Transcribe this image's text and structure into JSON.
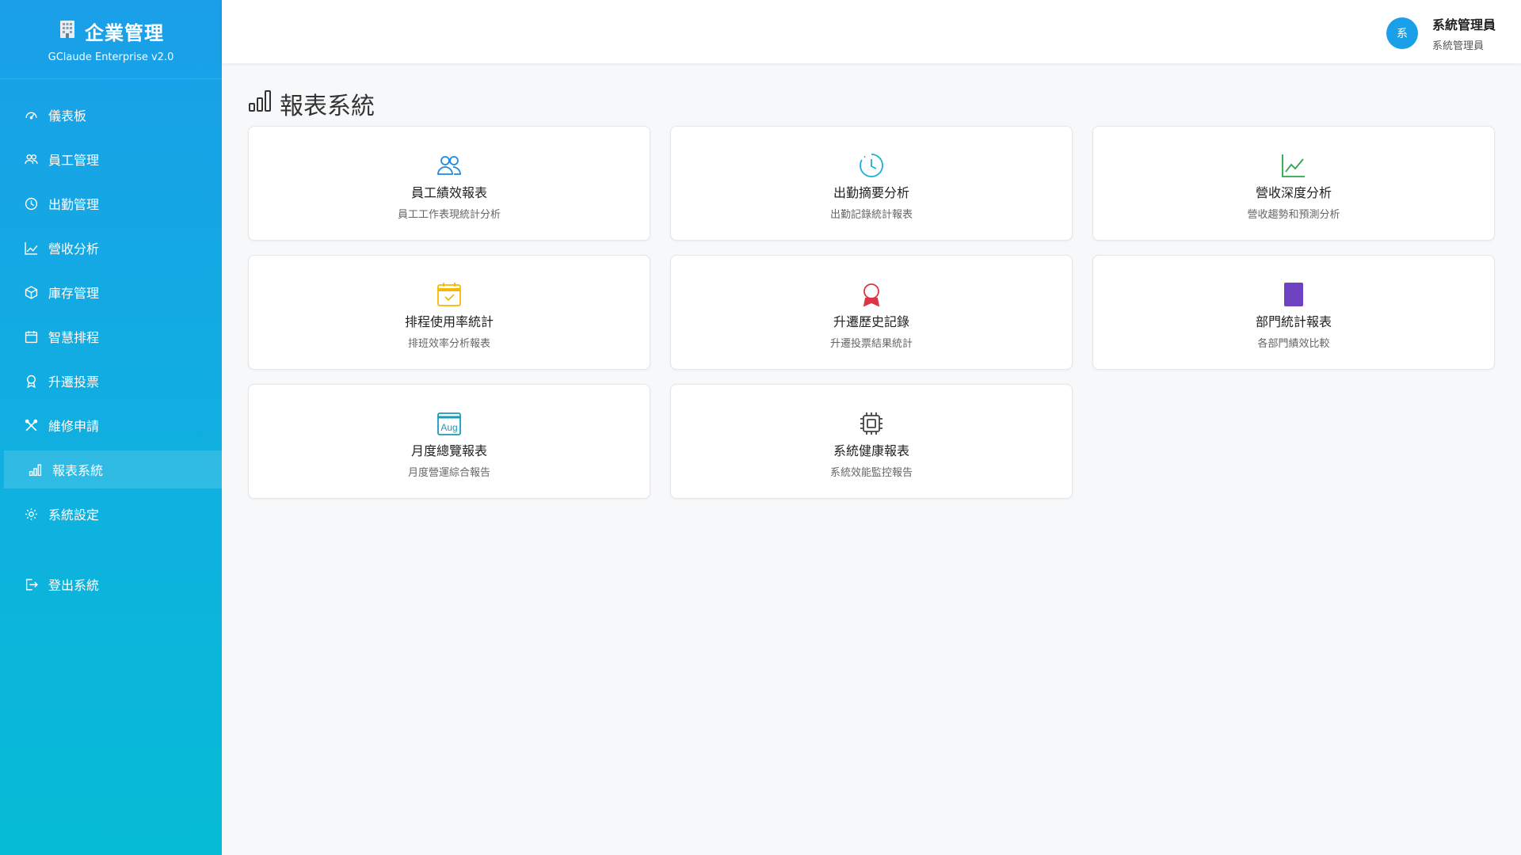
{
  "brand": {
    "title": "企業管理",
    "subtitle": "GClaude Enterprise v2.0"
  },
  "sidebar": {
    "items": [
      {
        "label": "儀表板",
        "icon": "speedometer-icon"
      },
      {
        "label": "員工管理",
        "icon": "people-icon"
      },
      {
        "label": "出勤管理",
        "icon": "clock-icon"
      },
      {
        "label": "營收分析",
        "icon": "graph-up-icon"
      },
      {
        "label": "庫存管理",
        "icon": "box-icon"
      },
      {
        "label": "智慧排程",
        "icon": "calendar-icon"
      },
      {
        "label": "升遷投票",
        "icon": "award-icon"
      },
      {
        "label": "維修申請",
        "icon": "tools-icon"
      },
      {
        "label": "報表系統",
        "icon": "bar-chart-icon",
        "active": true
      },
      {
        "label": "系統設定",
        "icon": "gear-icon"
      }
    ],
    "logout": "登出系統"
  },
  "header": {
    "avatar_text": "系",
    "user_name": "系統管理員",
    "user_role": "系統管理員"
  },
  "page": {
    "title": "報表系統"
  },
  "reports": [
    {
      "title": "員工績效報表",
      "desc": "員工工作表現統計分析",
      "icon": "people-icon",
      "color": "#1e88e5"
    },
    {
      "title": "出勤摘要分析",
      "desc": "出勤記錄統計報表",
      "icon": "clock-icon",
      "color": "#1ab0d5"
    },
    {
      "title": "營收深度分析",
      "desc": "營收趨勢和預測分析",
      "icon": "graph-up-icon",
      "color": "#28a745"
    },
    {
      "title": "排程使用率統計",
      "desc": "排班效率分析報表",
      "icon": "calendar-check-icon",
      "color": "#f5b800"
    },
    {
      "title": "升遷歷史記錄",
      "desc": "升遷投票結果統計",
      "icon": "award-icon",
      "color": "#dc3545"
    },
    {
      "title": "部門統計報表",
      "desc": "各部門績效比較",
      "icon": "book-icon",
      "color": "#6f42c1"
    },
    {
      "title": "月度總覽報表",
      "desc": "月度營運綜合報告",
      "icon": "calendar-month-icon",
      "color": "#1a9bb5",
      "icon_text": "Aug"
    },
    {
      "title": "系統健康報表",
      "desc": "系統效能監控報告",
      "icon": "cpu-icon",
      "color": "#444444"
    }
  ]
}
